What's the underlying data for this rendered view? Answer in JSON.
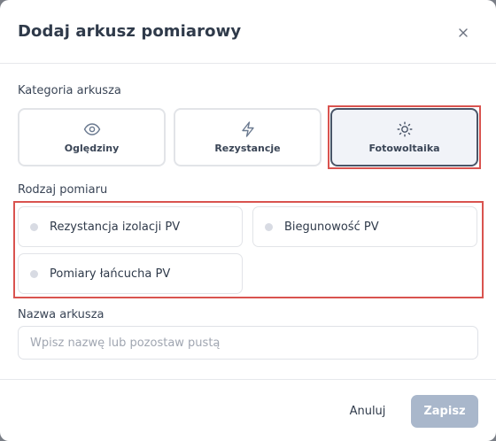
{
  "dialog": {
    "title": "Dodaj arkusz pomiarowy",
    "close_icon": "close-icon"
  },
  "category": {
    "label": "Kategoria arkusza",
    "options": [
      {
        "label": "Oględziny",
        "icon": "eye-icon",
        "selected": false
      },
      {
        "label": "Rezystancje",
        "icon": "lightning-icon",
        "selected": false
      },
      {
        "label": "Fotowoltaika",
        "icon": "sun-icon",
        "selected": true
      }
    ]
  },
  "measurement_type": {
    "label": "Rodzaj pomiaru",
    "options": [
      {
        "label": "Rezystancja izolacji PV"
      },
      {
        "label": "Biegunowość PV"
      },
      {
        "label": "Pomiary łańcucha PV"
      }
    ]
  },
  "sheet_name": {
    "label": "Nazwa arkusza",
    "value": "",
    "placeholder": "Wpisz nazwę lub pozostaw pustą"
  },
  "footer": {
    "cancel_label": "Anuluj",
    "save_label": "Zapisz"
  },
  "colors": {
    "highlight": "#d9534f",
    "selected_border": "#4a5568",
    "save_disabled": "#a9b7cb"
  }
}
